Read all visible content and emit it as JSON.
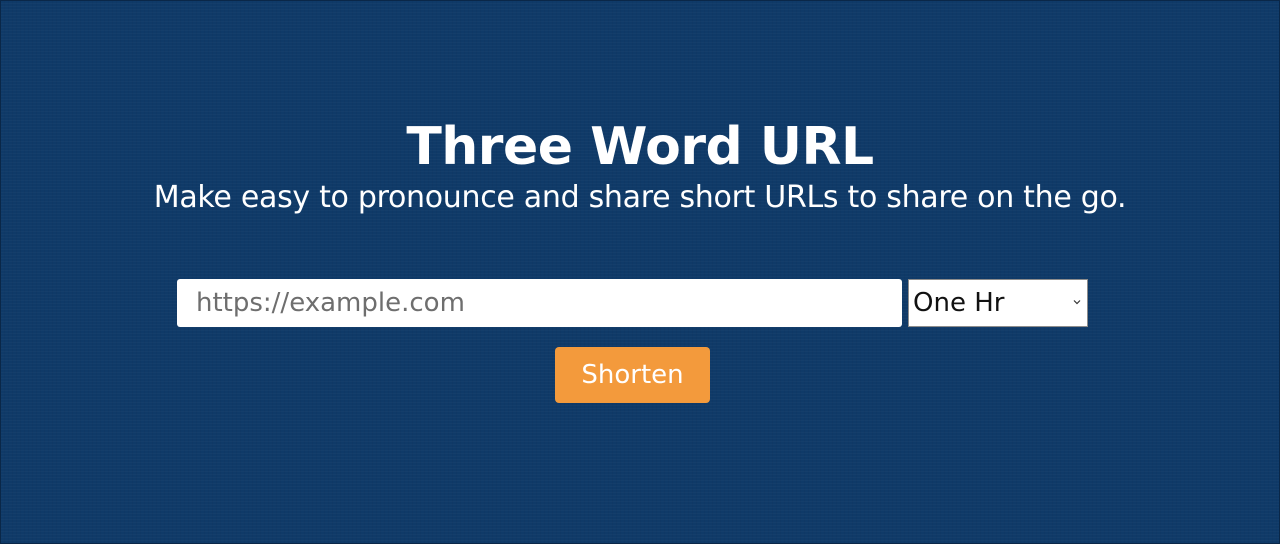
{
  "header": {
    "title": "Three Word URL",
    "subtitle": "Make easy to pronounce and share short URLs to share on the go."
  },
  "form": {
    "url_placeholder": "https://example.com",
    "url_value": "",
    "expiry_selected": "One Hr",
    "submit_label": "Shorten"
  },
  "colors": {
    "background": "#0f3a68",
    "button": "#f39a3c",
    "text": "#ffffff"
  },
  "icons": {
    "select_arrow": "chevron-down-icon"
  }
}
